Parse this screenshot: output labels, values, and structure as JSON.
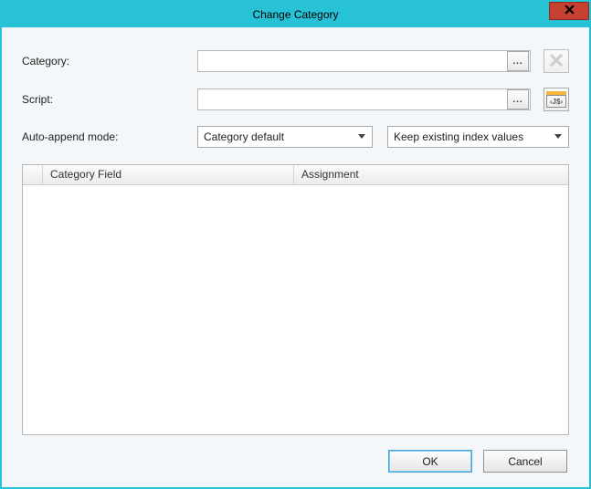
{
  "window": {
    "title": "Change Category"
  },
  "labels": {
    "category": "Category:",
    "script": "Script:",
    "auto_append_mode": "Auto-append mode:"
  },
  "inputs": {
    "category_value": "",
    "script_value": ""
  },
  "icons": {
    "ellipsis": "...",
    "clear": "x",
    "script_badge": "‹J$›"
  },
  "selects": {
    "auto_append_primary": "Category default",
    "auto_append_secondary": "Keep existing index values"
  },
  "table": {
    "columns": {
      "field": "Category Field",
      "assignment": "Assignment"
    },
    "rows": []
  },
  "buttons": {
    "ok": "OK",
    "cancel": "Cancel"
  }
}
